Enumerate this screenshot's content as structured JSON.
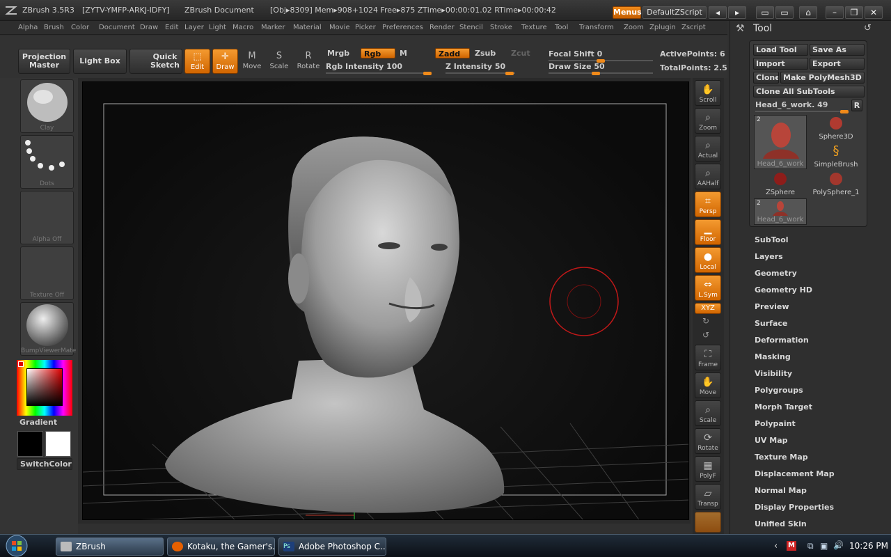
{
  "titlebar": {
    "app": "ZBrush 3.5R3",
    "serial": "[ZYTV-YMFP-ARKJ-IDFY]",
    "document": "ZBrush Document",
    "stats": "[Obj▸8309] Mem▸908+1024 Free▸875 ZTime▸00:00:01.02 RTime▸00:00:42",
    "menus_button": "Menus",
    "zscript_button": "DefaultZScript"
  },
  "menubar": [
    "Alpha",
    "Brush",
    "Color",
    "Document",
    "Draw",
    "Edit",
    "Layer",
    "Light",
    "Macro",
    "Marker",
    "Material",
    "Movie",
    "Picker",
    "Preferences",
    "Render",
    "Stencil",
    "Stroke",
    "Texture",
    "Tool",
    "Transform",
    "Zoom",
    "Zplugin",
    "Zscript"
  ],
  "toolbar": {
    "projection_master": "Projection Master",
    "light_box": "Light Box",
    "quick_sketch": "Quick Sketch",
    "edit": "Edit",
    "draw": "Draw",
    "move": "Move",
    "scale": "Scale",
    "rotate": "Rotate",
    "mrgb": "Mrgb",
    "rgb": "Rgb",
    "m": "M",
    "zadd": "Zadd",
    "zsub": "Zsub",
    "zcut": "Zcut",
    "rgb_intensity": "Rgb Intensity 100",
    "rgb_intensity_value": 100,
    "z_intensity": "Z Intensity 50",
    "z_intensity_value": 50,
    "focal_shift": "Focal Shift 0",
    "focal_shift_value": 0,
    "draw_size": "Draw Size 50",
    "draw_size_value": 50,
    "active_points": "ActivePoints: 6",
    "total_points": "TotalPoints: 2.5"
  },
  "left_shelf": {
    "brush": "Clay",
    "stroke": "Dots",
    "alpha": "Alpha Off",
    "texture": "Texture Off",
    "material": "BumpViewerMate",
    "gradient": "Gradient",
    "switch_color": "SwitchColor"
  },
  "right_shelf": [
    {
      "label": "Scroll",
      "icon": "hand-icon",
      "on": false
    },
    {
      "label": "Zoom",
      "icon": "magnifier-icon",
      "on": false
    },
    {
      "label": "Actual",
      "icon": "magnifier-icon",
      "on": false
    },
    {
      "label": "AAHalf",
      "icon": "magnifier-icon",
      "on": false
    },
    {
      "label": "Persp",
      "icon": "perspective-icon",
      "on": true
    },
    {
      "label": "Floor",
      "icon": "floor-icon",
      "on": true
    },
    {
      "label": "Local",
      "icon": "local-icon",
      "on": true
    },
    {
      "label": "L.Sym",
      "icon": "symmetry-icon",
      "on": true
    },
    {
      "label": "XYZ",
      "icon": "xyz-icon",
      "on": true
    },
    {
      "label": "Frame",
      "icon": "frame-icon",
      "on": false
    },
    {
      "label": "Move",
      "icon": "move-icon",
      "on": false
    },
    {
      "label": "Scale",
      "icon": "scale-icon",
      "on": false
    },
    {
      "label": "Rotate",
      "icon": "rotate-icon",
      "on": false
    },
    {
      "label": "PolyF",
      "icon": "polyframe-icon",
      "on": false
    },
    {
      "label": "Transp",
      "icon": "transparency-icon",
      "on": false
    }
  ],
  "tool_panel": {
    "title": "Tool",
    "load_tool": "Load Tool",
    "save_as": "Save As",
    "import": "Import",
    "export": "Export",
    "clone": "Clone",
    "make_polymesh": "Make PolyMesh3D",
    "clone_all": "Clone All SubTools",
    "current_tool": "Head_6_work. 49",
    "r_button": "R",
    "tools": [
      {
        "name": "Head_6_work",
        "badge": "2"
      },
      {
        "name": "Sphere3D"
      },
      {
        "name": "SimpleBrush"
      },
      {
        "name": "ZSphere"
      },
      {
        "name": "PolySphere_1"
      },
      {
        "name": "Head_6_work",
        "badge": "2"
      }
    ],
    "subpalettes": [
      "SubTool",
      "Layers",
      "Geometry",
      "Geometry HD",
      "Preview",
      "Surface",
      "Deformation",
      "Masking",
      "Visibility",
      "Polygroups",
      "Morph Target",
      "Polypaint",
      "UV Map",
      "Texture Map",
      "Displacement Map",
      "Normal Map",
      "Display Properties",
      "Unified Skin"
    ]
  },
  "taskbar": {
    "tasks": [
      "ZBrush",
      "Kotaku, the Gamer's...",
      "Adobe Photoshop C..."
    ],
    "clock": "10:26 PM"
  }
}
